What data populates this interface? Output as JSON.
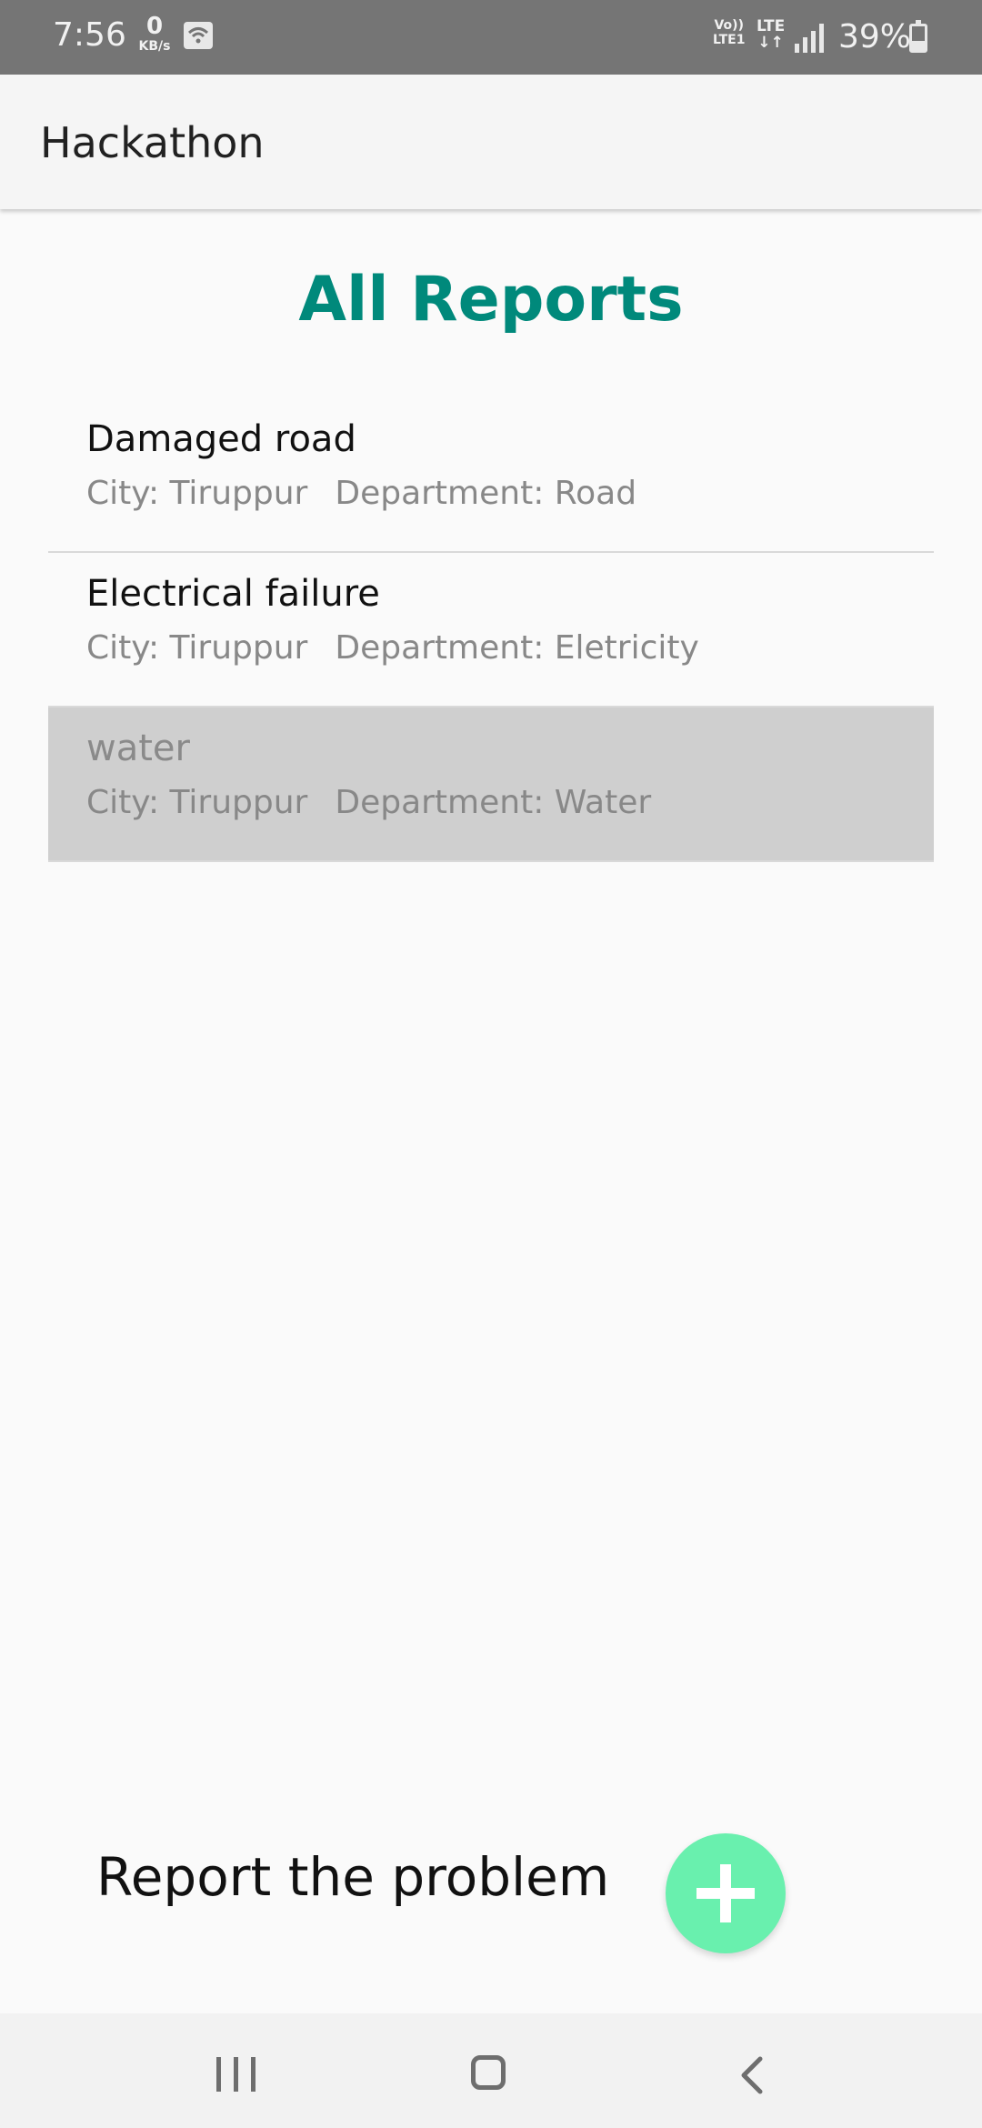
{
  "status_bar": {
    "time": "7:56",
    "net_speed_value": "0",
    "net_speed_unit": "KB/s",
    "volte_top": "Vo))",
    "volte_bottom": "LTE1",
    "lte_top": "LTE",
    "lte_bottom": "↓↑",
    "battery_percent": "39%",
    "battery_level": 0.39
  },
  "app_bar": {
    "title": "Hackathon"
  },
  "page": {
    "title": "All Reports"
  },
  "reports": [
    {
      "title": "Damaged road",
      "city": "City: Tiruppur",
      "department": "Department: Road"
    },
    {
      "title": "Electrical failure",
      "city": "City: Tiruppur",
      "department": "Department: Eletricity"
    },
    {
      "title": "water",
      "city": "City: Tiruppur",
      "department": "Department: Water"
    }
  ],
  "action": {
    "label": "Report the problem"
  },
  "colors": {
    "accent": "#00897b",
    "fab": "#69f0ae",
    "selected_row": "#cfcfcf"
  },
  "icons": [
    "wifi-icon",
    "signal-icon",
    "battery-icon",
    "add-icon",
    "recents-icon",
    "home-icon",
    "back-icon"
  ]
}
